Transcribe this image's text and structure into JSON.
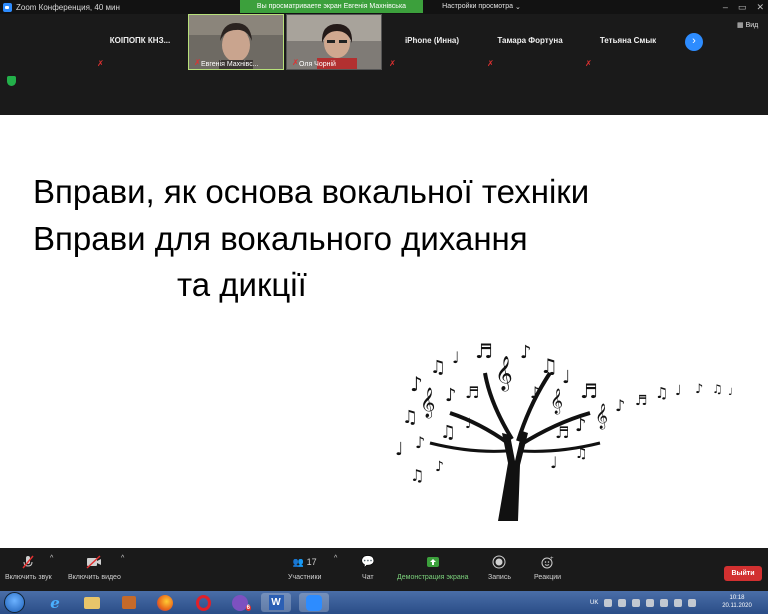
{
  "window": {
    "title": "Zoom Конференция, 40 мин",
    "share_banner": "Вы просматриваете экран Евгенія Махнівська",
    "view_options": "Настройки просмотра",
    "view_button": "Вид"
  },
  "participants": [
    {
      "name": "КОІПОПК КНЗ..."
    },
    {
      "name": "Евгенія Махнівс..."
    },
    {
      "name": "Оля Чорній"
    },
    {
      "name": "iPhone (Инна)"
    },
    {
      "name": "Тамара Фортуна"
    },
    {
      "name": "Тетьяна Смык"
    }
  ],
  "slide": {
    "line1": "Вправи, як основа вокальної техніки",
    "line2": "Вправи для вокального дихання",
    "line3": "та дикції"
  },
  "controls": {
    "mute": "Включить звук",
    "video": "Включить видео",
    "participants": "Участники",
    "participants_count": "17",
    "chat": "Чат",
    "share": "Демонстрация экрана",
    "record": "Запись",
    "reactions": "Реакции",
    "end": "Выйти"
  },
  "taskbar": {
    "lang": "UK",
    "time": "10:18",
    "date": "20.11.2020",
    "opera_badge": "",
    "viber_badge": "6"
  },
  "colors": {
    "zoom_blue": "#2d8cff",
    "share_green": "#3ca03c",
    "end_red": "#d23030"
  }
}
